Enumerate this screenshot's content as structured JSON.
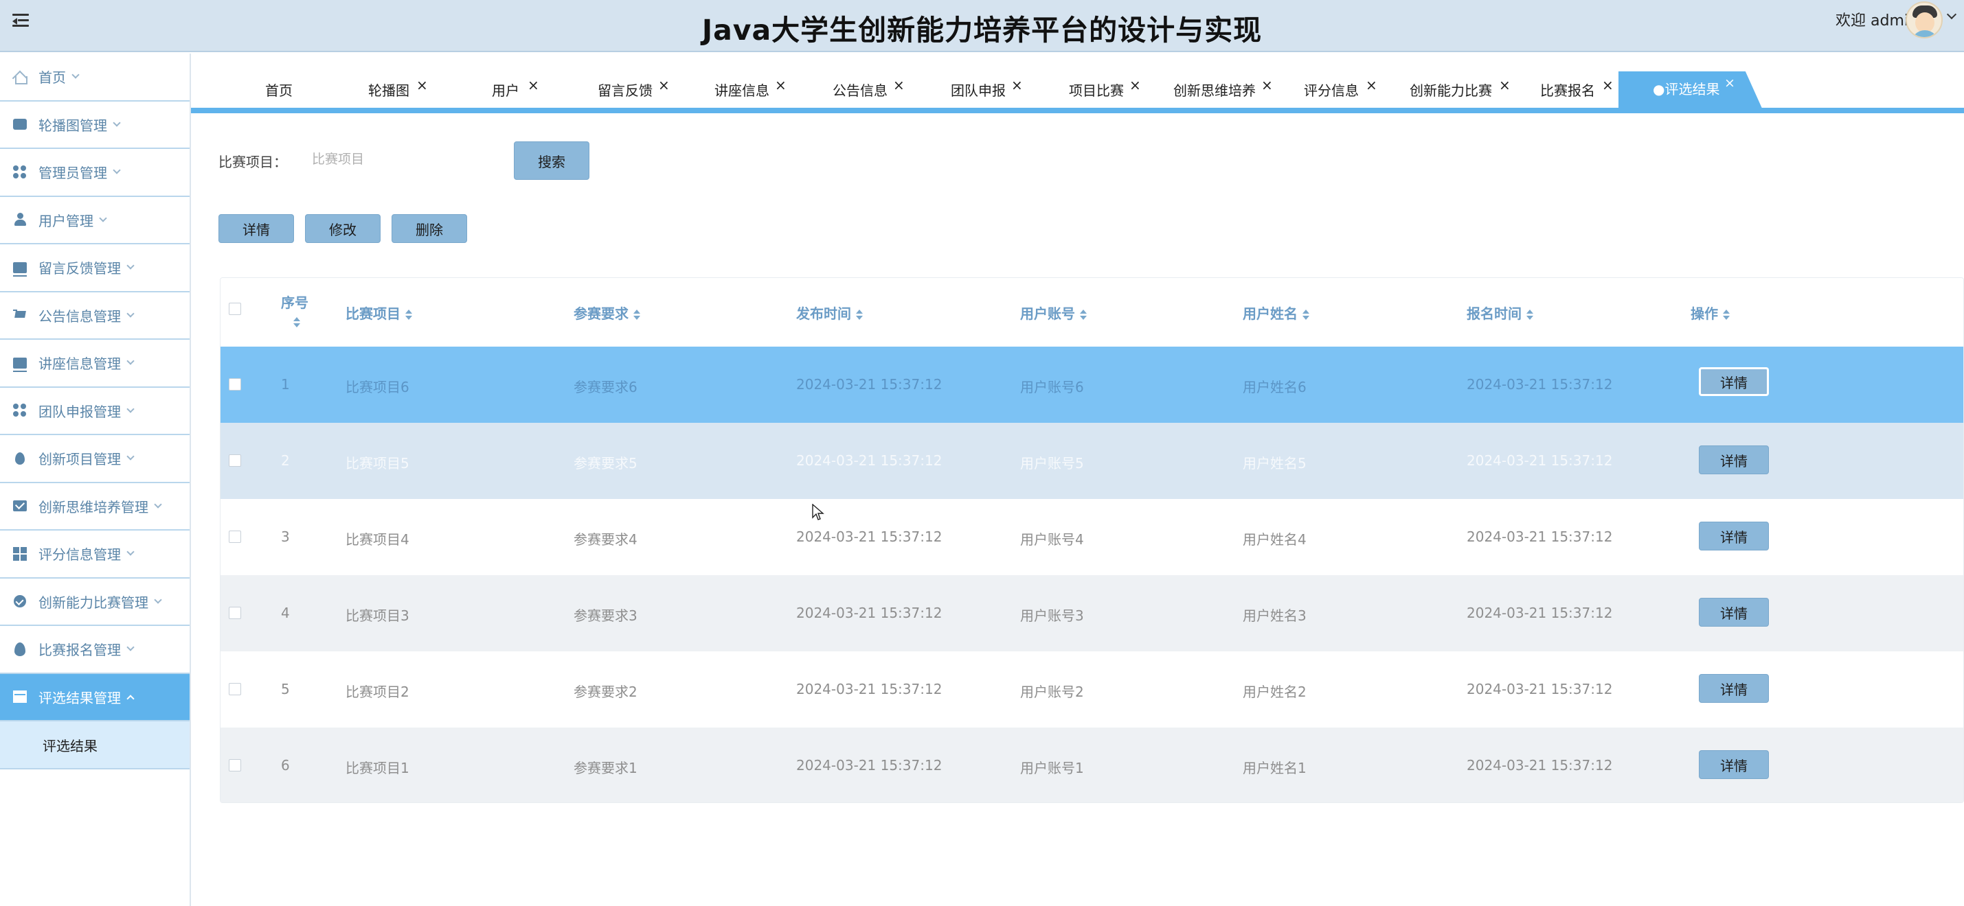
{
  "header": {
    "title": "Java大学生创新能力培养平台的设计与实现",
    "welcome": "欢迎 admin"
  },
  "sidebar": {
    "items": [
      {
        "label": "首页",
        "icon": "home-icon"
      },
      {
        "label": "轮播图管理",
        "icon": "carousel-icon"
      },
      {
        "label": "管理员管理",
        "icon": "admin-icon"
      },
      {
        "label": "用户管理",
        "icon": "user-icon"
      },
      {
        "label": "留言反馈管理",
        "icon": "feedback-icon"
      },
      {
        "label": "公告信息管理",
        "icon": "notice-icon"
      },
      {
        "label": "讲座信息管理",
        "icon": "lecture-icon"
      },
      {
        "label": "团队申报管理",
        "icon": "team-icon"
      },
      {
        "label": "创新项目管理",
        "icon": "project-icon"
      },
      {
        "label": "创新思维培养管理",
        "icon": "thinking-icon"
      },
      {
        "label": "评分信息管理",
        "icon": "score-icon"
      },
      {
        "label": "创新能力比赛管理",
        "icon": "contest-icon"
      },
      {
        "label": "比赛报名管理",
        "icon": "signup-icon"
      },
      {
        "label": "评选结果管理",
        "icon": "result-icon"
      }
    ],
    "sub_item": "评选结果"
  },
  "tabs": [
    {
      "label": "首页"
    },
    {
      "label": "轮播图"
    },
    {
      "label": "用户"
    },
    {
      "label": "留言反馈"
    },
    {
      "label": "讲座信息"
    },
    {
      "label": "公告信息"
    },
    {
      "label": "团队申报"
    },
    {
      "label": "项目比赛"
    },
    {
      "label": "创新思维培养"
    },
    {
      "label": "评分信息"
    },
    {
      "label": "创新能力比赛"
    },
    {
      "label": "比赛报名"
    },
    {
      "label": "●评选结果"
    }
  ],
  "search": {
    "label": "比赛项目：",
    "placeholder": "比赛项目",
    "button": "搜索"
  },
  "actions": {
    "detail": "详情",
    "edit": "修改",
    "delete": "删除"
  },
  "table": {
    "columns": [
      "序号",
      "比赛项目",
      "参赛要求",
      "发布时间",
      "用户账号",
      "用户姓名",
      "报名时间",
      "操作"
    ],
    "rows": [
      {
        "no": "1",
        "project": "比赛项目6",
        "req": "参赛要求6",
        "pub": "2024-03-21 15:37:12",
        "account": "用户账号6",
        "name": "用户姓名6",
        "signup": "2024-03-21 15:37:12",
        "op": "详情"
      },
      {
        "no": "2",
        "project": "比赛项目5",
        "req": "参赛要求5",
        "pub": "2024-03-21 15:37:12",
        "account": "用户账号5",
        "name": "用户姓名5",
        "signup": "2024-03-21 15:37:12",
        "op": "详情"
      },
      {
        "no": "3",
        "project": "比赛项目4",
        "req": "参赛要求4",
        "pub": "2024-03-21 15:37:12",
        "account": "用户账号4",
        "name": "用户姓名4",
        "signup": "2024-03-21 15:37:12",
        "op": "详情"
      },
      {
        "no": "4",
        "project": "比赛项目3",
        "req": "参赛要求3",
        "pub": "2024-03-21 15:37:12",
        "account": "用户账号3",
        "name": "用户姓名3",
        "signup": "2024-03-21 15:37:12",
        "op": "详情"
      },
      {
        "no": "5",
        "project": "比赛项目2",
        "req": "参赛要求2",
        "pub": "2024-03-21 15:37:12",
        "account": "用户账号2",
        "name": "用户姓名2",
        "signup": "2024-03-21 15:37:12",
        "op": "详情"
      },
      {
        "no": "6",
        "project": "比赛项目1",
        "req": "参赛要求1",
        "pub": "2024-03-21 15:37:12",
        "account": "用户账号1",
        "name": "用户姓名1",
        "signup": "2024-03-21 15:37:12",
        "op": "详情"
      }
    ]
  },
  "colors": {
    "accent": "#5fb3ec",
    "header_bg": "#d5e3ef",
    "button": "#8cb8da"
  }
}
